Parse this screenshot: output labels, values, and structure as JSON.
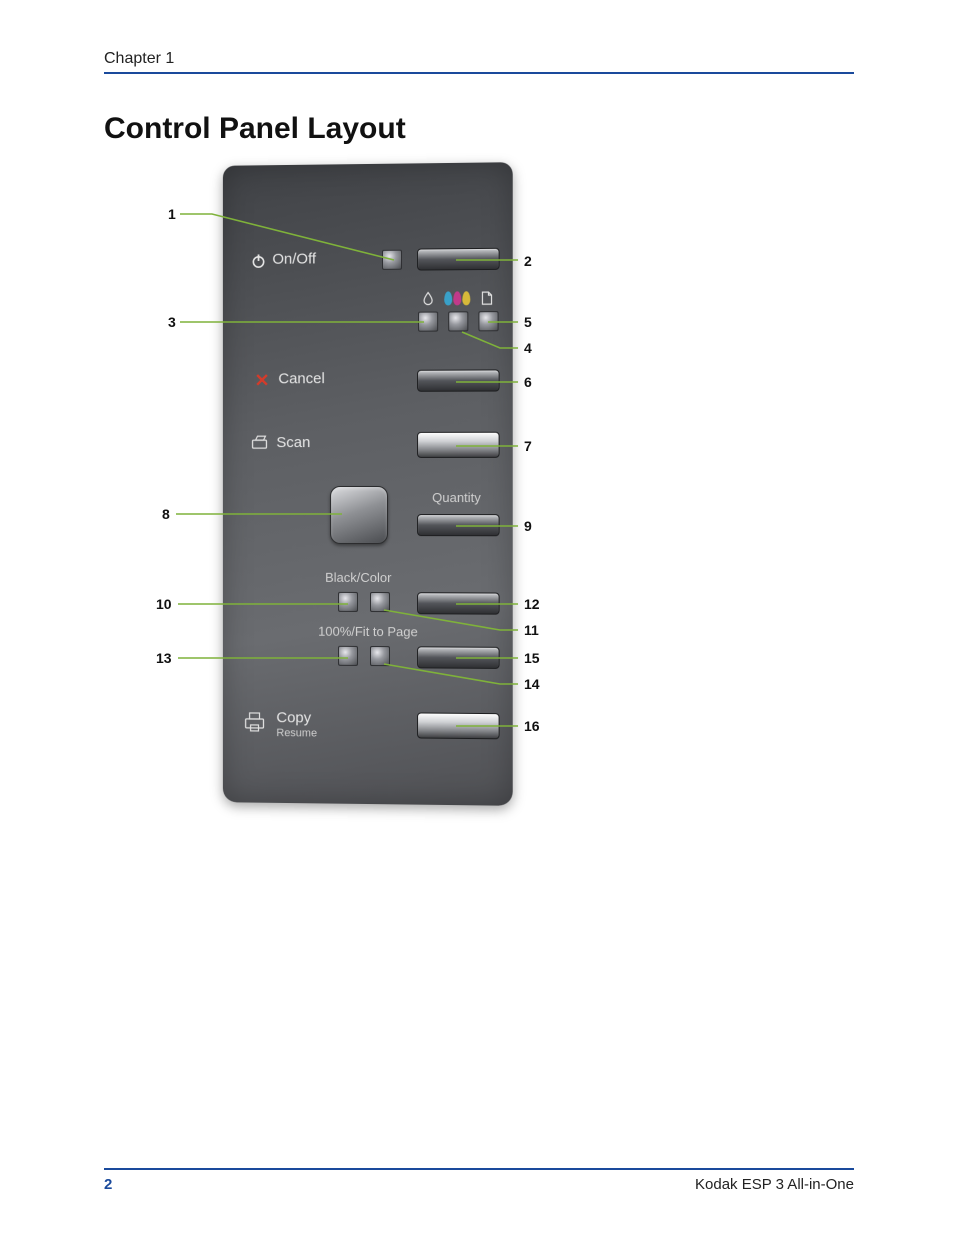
{
  "header": {
    "chapter": "Chapter 1"
  },
  "title": "Control Panel Layout",
  "panel": {
    "onoff": "On/Off",
    "cancel": "Cancel",
    "scan": "Scan",
    "quantity": "Quantity",
    "blackcolor": "Black/Color",
    "fit": "100%/Fit to Page",
    "copy": "Copy",
    "resume": "Resume"
  },
  "callouts": {
    "n1": "1",
    "n2": "2",
    "n3": "3",
    "n4": "4",
    "n5": "5",
    "n6": "6",
    "n7": "7",
    "n8": "8",
    "n9": "9",
    "n10": "10",
    "n11": "11",
    "n12": "12",
    "n13": "13",
    "n14": "14",
    "n15": "15",
    "n16": "16"
  },
  "footer": {
    "page": "2",
    "product": "Kodak ESP 3 All-in-One"
  }
}
